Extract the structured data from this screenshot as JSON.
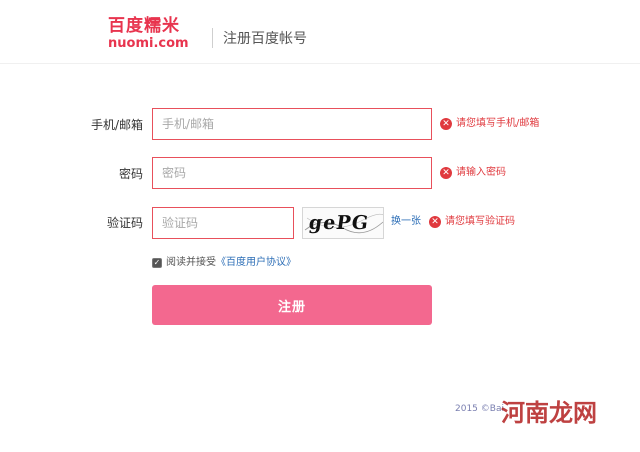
{
  "header": {
    "logo_cn": "百度糯米",
    "logo_en": "nuomi.com",
    "title": "注册百度帐号"
  },
  "form": {
    "phone": {
      "label": "手机/邮箱",
      "placeholder": "手机/邮箱",
      "error": "请您填写手机/邮箱"
    },
    "password": {
      "label": "密码",
      "placeholder": "密码",
      "error": "请输入密码"
    },
    "captcha": {
      "label": "验证码",
      "placeholder": "验证码",
      "image_text": "gePG",
      "refresh_label": "换一张",
      "error": "请您填写验证码"
    },
    "agreement": {
      "checked": true,
      "prefix": "阅读并接受",
      "link": "《百度用户协议》"
    },
    "submit_label": "注册"
  },
  "footer": {
    "copyright": "2015 ©Bai"
  },
  "watermark": "河南龙网",
  "icons": {
    "error": "error-x-circle-icon",
    "checkbox": "check-icon"
  },
  "colors": {
    "brand": "#e8344e",
    "error": "#e0393e",
    "submit": "#f3688f",
    "link": "#2e6fb7"
  }
}
